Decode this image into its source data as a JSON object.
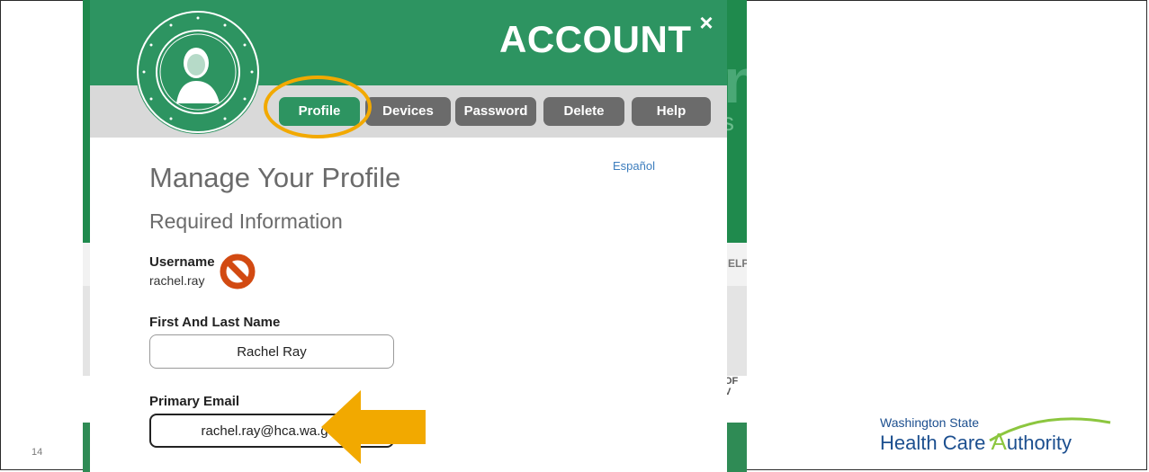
{
  "slide": {
    "number": "14"
  },
  "modal": {
    "title": "ACCOUNT",
    "close_icon": "×",
    "tabs": [
      {
        "label": "Profile",
        "active": true
      },
      {
        "label": "Devices",
        "active": false
      },
      {
        "label": "Password",
        "active": false
      },
      {
        "label": "Delete",
        "active": false
      },
      {
        "label": "Help",
        "active": false
      }
    ],
    "language_link": "Español",
    "heading": "Manage Your Profile",
    "section": "Required Information",
    "username": {
      "label": "Username",
      "value": "rachel.ray"
    },
    "name": {
      "label": "First And Last Name",
      "value": "Rachel Ray"
    },
    "email": {
      "label": "Primary Email",
      "value": "rachel.ray@hca.wa.gov"
    }
  },
  "background": {
    "nav_right": "ELP",
    "nav_left": "S",
    "edge_right": "OF V"
  },
  "logo": {
    "line1": "Washington State",
    "line2_a": "Health Care ",
    "line2_b": "uthority"
  },
  "colors": {
    "header_green": "#2d9461",
    "tab_gray": "#6b6b6b",
    "highlight": "#f2a900",
    "no_icon": "#d24a12",
    "logo_blue": "#1c4f8f",
    "logo_green": "#8cc63f"
  },
  "icons": [
    "close-icon",
    "state-seal-icon",
    "no-entry-icon",
    "arrow-left-icon"
  ]
}
